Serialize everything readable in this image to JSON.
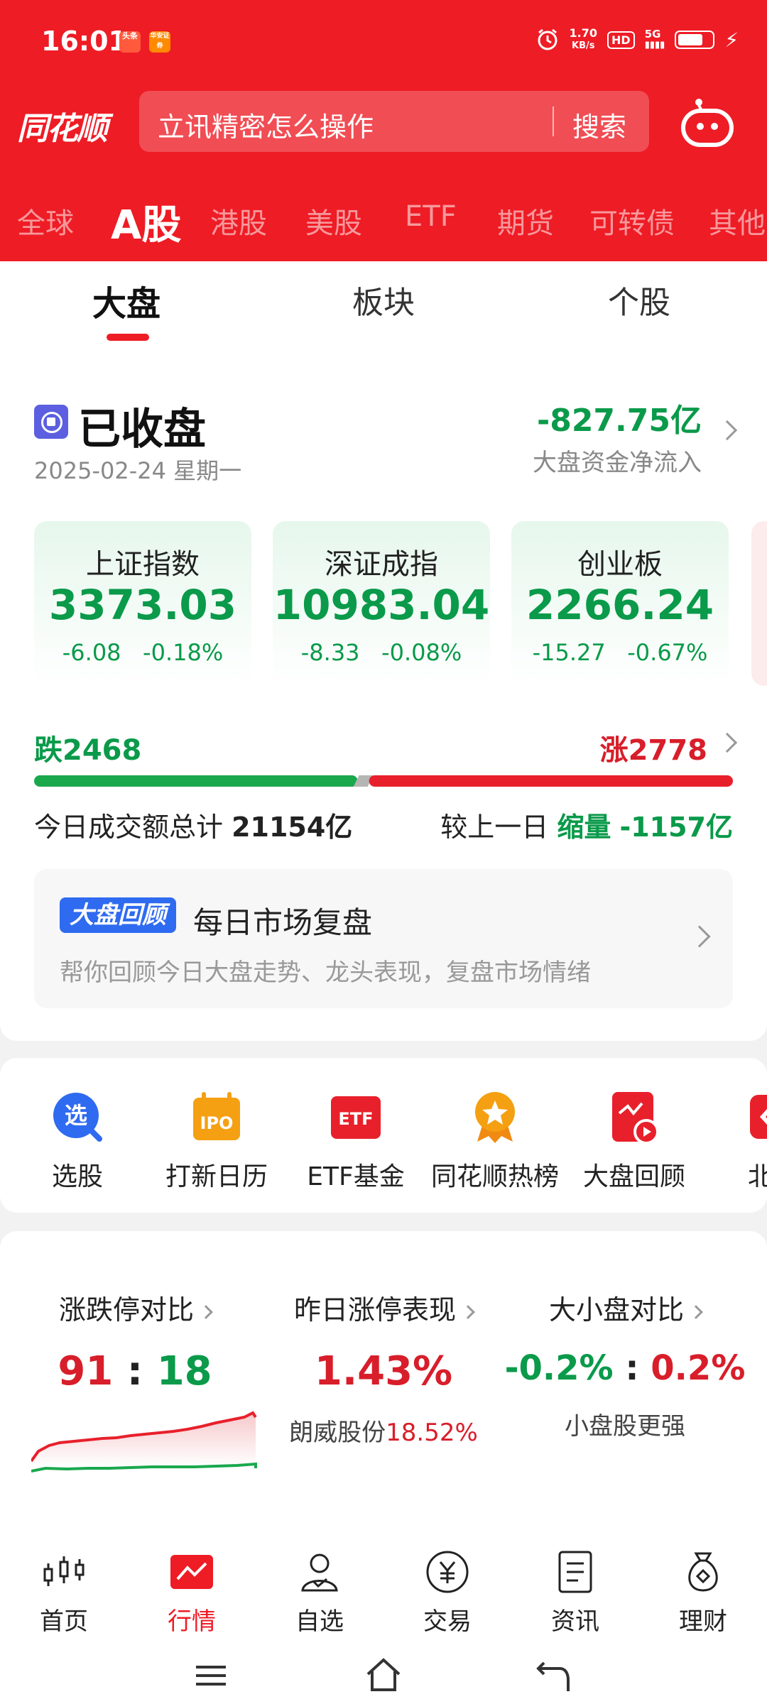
{
  "status_bar": {
    "time": "16:01",
    "badge1": "头条",
    "badge2": "华安证券",
    "net_speed_value": "1.70",
    "net_speed_unit": "KB/s",
    "hd": "HD",
    "signal": "5G"
  },
  "header": {
    "logo": "同花顺",
    "search_placeholder": "立讯精密怎么操作",
    "search_button": "搜索",
    "market_tabs": [
      "全球",
      "A股",
      "港股",
      "美股",
      "ETF",
      "期货",
      "可转债",
      "其他"
    ],
    "active_market_tab": "A股"
  },
  "sub_tabs": [
    "大盘",
    "板块",
    "个股"
  ],
  "market_status": {
    "title": "已收盘",
    "date": "2025-02-24 星期一",
    "net_inflow_value": "-827.75亿",
    "net_inflow_label": "大盘资金净流入"
  },
  "indices": [
    {
      "name": "上证指数",
      "value": "3373.03",
      "change": "-6.08",
      "pct": "-0.18%"
    },
    {
      "name": "深证成指",
      "value": "10983.04",
      "change": "-8.33",
      "pct": "-0.08%"
    },
    {
      "name": "创业板",
      "value": "2266.24",
      "change": "-15.27",
      "pct": "-0.67%"
    }
  ],
  "breadth": {
    "fall_label": "跌2468",
    "rise_label": "涨2778",
    "fall_count": 2468,
    "rise_count": 2778
  },
  "volume": {
    "total_label": "今日成交额总计",
    "total_value": "21154亿",
    "compare_label": "较上一日",
    "compare_state": "缩量",
    "compare_value": "-1157亿"
  },
  "review": {
    "badge": "大盘回顾",
    "title": "每日市场复盘",
    "desc": "帮你回顾今日大盘走势、龙头表现，复盘市场情绪"
  },
  "tools": [
    {
      "label": "选股",
      "icon": "select-stock-icon",
      "glyph": "选"
    },
    {
      "label": "打新日历",
      "icon": "ipo-calendar-icon",
      "glyph": "IPO"
    },
    {
      "label": "ETF基金",
      "icon": "etf-fund-icon",
      "glyph": "ETF"
    },
    {
      "label": "同花顺热榜",
      "icon": "hot-list-icon",
      "glyph": ""
    },
    {
      "label": "大盘回顾",
      "icon": "market-review-icon",
      "glyph": ""
    },
    {
      "label": "北交",
      "icon": "bse-icon",
      "glyph": ""
    }
  ],
  "stats": {
    "limit": {
      "title": "涨跌停对比",
      "up": "91",
      "sep": ":",
      "down": "18"
    },
    "yesterday": {
      "title": "昨日涨停表现",
      "value": "1.43%",
      "stock": "朗威股份",
      "stock_pct": "18.52%"
    },
    "size": {
      "title": "大小盘对比",
      "left": "-0.2%",
      "sep": ":",
      "right": "0.2%",
      "note": "小盘股更强"
    }
  },
  "bottom_nav": [
    "首页",
    "行情",
    "自选",
    "交易",
    "资讯",
    "理财"
  ],
  "colors": {
    "brand_red": "#ee1c25",
    "up_red": "#d81e2a",
    "down_green": "#0a9a4a"
  }
}
